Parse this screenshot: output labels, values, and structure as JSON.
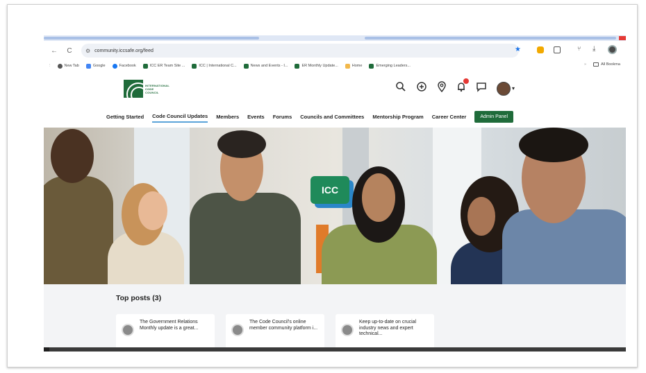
{
  "browser": {
    "url": "community.iccsafe.org/feed",
    "nav": {
      "back": "←",
      "reload": "C",
      "tune": "⚙"
    },
    "toolbar": {
      "star": "★",
      "ext_puzzle": "⋮",
      "download": "⤓",
      "filter": "⑂"
    },
    "bookmarks": [
      {
        "label": "New Tab",
        "color": "#555555"
      },
      {
        "label": "Google",
        "color": "#4285f4"
      },
      {
        "label": "Facebook",
        "color": "#1877f2"
      },
      {
        "label": "ICC ER Team Site ...",
        "color": "#1f6b3a"
      },
      {
        "label": "ICC | International C...",
        "color": "#1f6b3a"
      },
      {
        "label": "News and Events - I...",
        "color": "#1f6b3a"
      },
      {
        "label": "ER Monthly Update...",
        "color": "#1f6b3a"
      },
      {
        "label": "Home",
        "color": "#f2b84b"
      },
      {
        "label": "Emerging Leaders...",
        "color": "#1f6b3a"
      }
    ],
    "bookmarks_overflow": "»",
    "all_bookmarks": "All Bookma"
  },
  "site": {
    "logo_lines": [
      "INTERNATIONAL",
      "CODE",
      "COUNCIL"
    ],
    "header_icons": [
      "search-icon",
      "add-circle-icon",
      "location-pin-icon",
      "bell-icon",
      "chat-icon"
    ],
    "header_glyphs": {
      "search": "⚲",
      "add": "⊕",
      "location": "⚲",
      "bell": "♫",
      "chat": "☐"
    },
    "caret": "▾",
    "nav": [
      {
        "label": "Getting Started",
        "active": false
      },
      {
        "label": "Code Council Updates",
        "active": true
      },
      {
        "label": "Members",
        "active": false
      },
      {
        "label": "Events",
        "active": false
      },
      {
        "label": "Forums",
        "active": false
      },
      {
        "label": "Councils and Committees",
        "active": false
      },
      {
        "label": "Mentorship Program",
        "active": false
      },
      {
        "label": "Career Center",
        "active": false
      }
    ],
    "admin_button": "Admin Panel",
    "hero_sign": "ICC",
    "colors": {
      "brand_green": "#1f6b3a",
      "accent_blue": "#5aa3d9"
    }
  },
  "feed": {
    "top_posts_title": "Top posts (3)",
    "posts": [
      {
        "text": "The Government Relations Monthly update is a great..."
      },
      {
        "text": "The Code Council's online member community platform i..."
      },
      {
        "text": "Keep up-to-date on crucial industry news and expert technical..."
      }
    ]
  }
}
